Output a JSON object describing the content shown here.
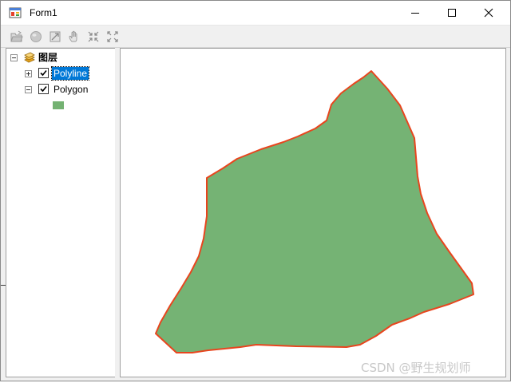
{
  "window": {
    "title": "Form1",
    "icon": "winforms-app-icon",
    "controls": [
      "minimize-icon",
      "maximize-icon",
      "close-icon"
    ]
  },
  "toolbar": {
    "tools": [
      "open-icon",
      "globe-icon",
      "zoom-extent-icon",
      "pan-hand-icon",
      "zoom-in-fixed-icon",
      "zoom-out-fixed-icon"
    ]
  },
  "toc": {
    "root": {
      "label": "图层",
      "icon": "layers-icon",
      "expanded": true
    },
    "layers": [
      {
        "label": "Polyline",
        "checked": true,
        "expanded": false,
        "selected": true
      },
      {
        "label": "Polygon",
        "checked": true,
        "expanded": true,
        "selected": false,
        "symbol_color": "#74b272"
      }
    ]
  },
  "map": {
    "fill_color": "#75b374",
    "outline_color": "#e8451e"
  },
  "watermark": {
    "text": "CSDN @野生规划师"
  },
  "colors": {
    "selection": "#0078d7",
    "window_bg": "#f0f0f0"
  }
}
